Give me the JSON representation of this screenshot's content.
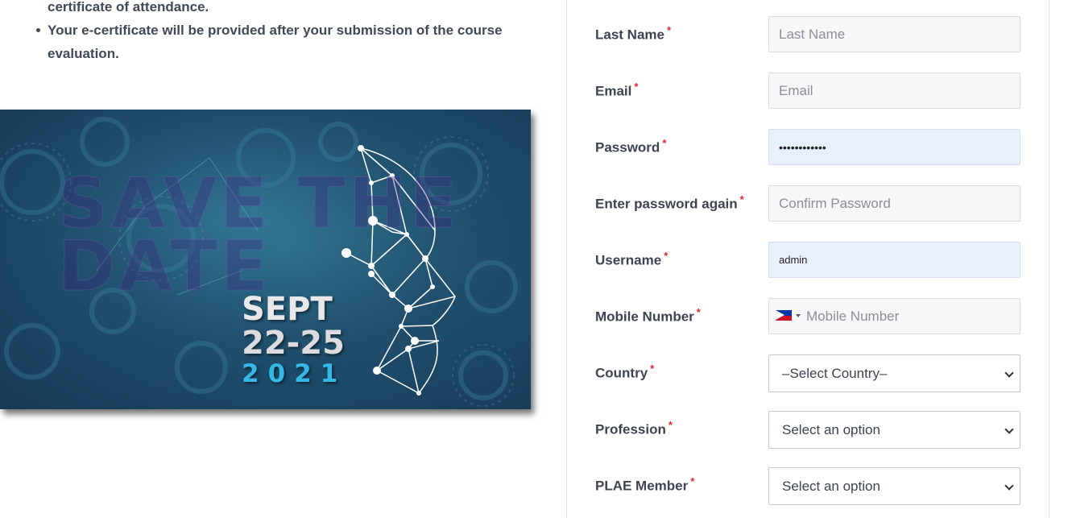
{
  "intro": {
    "continuation": "certificate of attendance.",
    "bullet_text": "Your e-certificate will be provided after your submission of the course evaluation."
  },
  "banner": {
    "background_text": "SAVE THE\nDATE",
    "month": "SEPT",
    "days": "22-25",
    "year": "2021",
    "accent_color": "#35b8e6"
  },
  "form": {
    "required_marker": "*",
    "last_name": {
      "label": "Last Name",
      "placeholder": "Last Name",
      "value": ""
    },
    "email": {
      "label": "Email",
      "placeholder": "Email",
      "value": ""
    },
    "password": {
      "label": "Password",
      "value": "••••••••••••"
    },
    "confirm_password": {
      "label": "Enter password again",
      "placeholder": "Confirm Password",
      "value": ""
    },
    "username": {
      "label": "Username",
      "value": "admin"
    },
    "mobile": {
      "label": "Mobile Number",
      "placeholder": "Mobile Number",
      "flag_icon": "philippines-flag-icon"
    },
    "country": {
      "label": "Country",
      "selected": "–Select Country–"
    },
    "profession": {
      "label": "Profession",
      "selected": "Select an option"
    },
    "plae_member": {
      "label": "PLAE Member",
      "selected": "Select an option"
    }
  },
  "colors": {
    "required": "#e0262f",
    "autofill_bg": "#e8f0fe",
    "label": "#3c4452"
  }
}
